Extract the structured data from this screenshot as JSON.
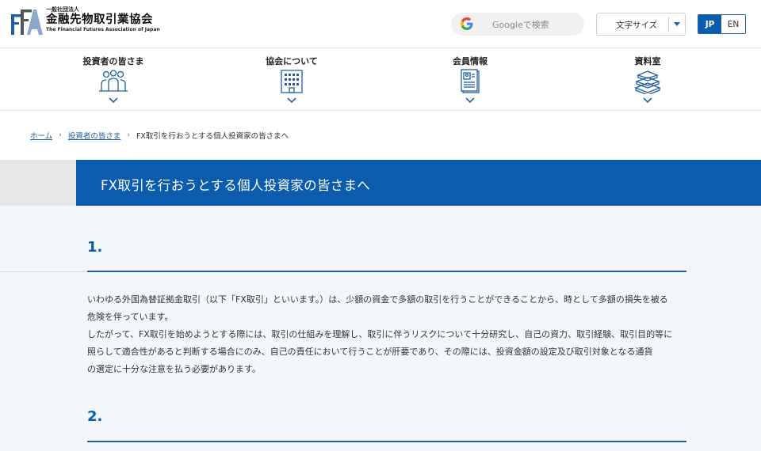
{
  "header": {
    "logo": {
      "sub": "一般社団法人",
      "main": "金融先物取引業協会",
      "en": "The Financial Futures Association of Japan"
    },
    "search": {
      "placeholder": "Googleで検索"
    },
    "font_size": {
      "label": "文字サイズ"
    },
    "lang": {
      "jp": "JP",
      "en": "EN"
    }
  },
  "nav": {
    "items": [
      {
        "label": "投資者の皆さま",
        "icon": "people-icon"
      },
      {
        "label": "協会について",
        "icon": "building-icon"
      },
      {
        "label": "会員情報",
        "icon": "member-document-icon"
      },
      {
        "label": "資料室",
        "icon": "books-icon"
      }
    ]
  },
  "breadcrumb": {
    "home": "ホーム",
    "investors": "投資者の皆さま",
    "current": "FX取引を行おうとする個人投資家の皆さまへ"
  },
  "page": {
    "title": "FX取引を行おうとする個人投資家の皆さまへ",
    "sections": [
      {
        "num": "1.",
        "lines": [
          "いわゆる外国為替証拠金取引（以下「FX取引」といいます。）は、少額の資金で多額の取引を行うことができることから、時として多額の損失を被る",
          "危険を伴っています。",
          "したがって、FX取引を始めようとする際には、取引の仕組みを理解し、取引に伴うリスクについて十分研究し、自己の資力、取引経験、取引目的等に",
          "照らして適合性があると判断する場合にのみ、自己の責任において行うことが肝要であり、その際には、投資金額の設定及び取引対象となる通貨",
          "の選定に十分な注意を払う必要があります。"
        ]
      },
      {
        "num": "2."
      }
    ]
  },
  "colors": {
    "brand_blue": "#0b5cad",
    "band_grey": "#e6e6e6",
    "content_bg": "#f4f7fa"
  }
}
